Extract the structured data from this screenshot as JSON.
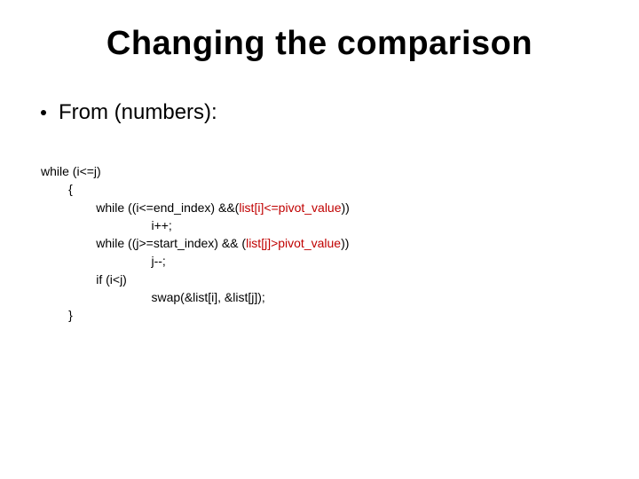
{
  "title": "Changing the comparison",
  "bullet": "From (numbers):",
  "code": {
    "l1": "while (i<=j)",
    "l2": "        {",
    "l3a": "                while ((i<=end_index) &&(",
    "l3_hl": "list[i]<=pivot_value",
    "l3b": "))",
    "l4": "                                i++;",
    "l5a": "                while ((j>=start_index) && (",
    "l5_hl": "list[j]>pivot_value",
    "l5b": "))",
    "l6": "                                j--;",
    "l7": "                if (i<j)",
    "l8": "                                swap(&list[i], &list[j]);",
    "l9": "        }"
  }
}
